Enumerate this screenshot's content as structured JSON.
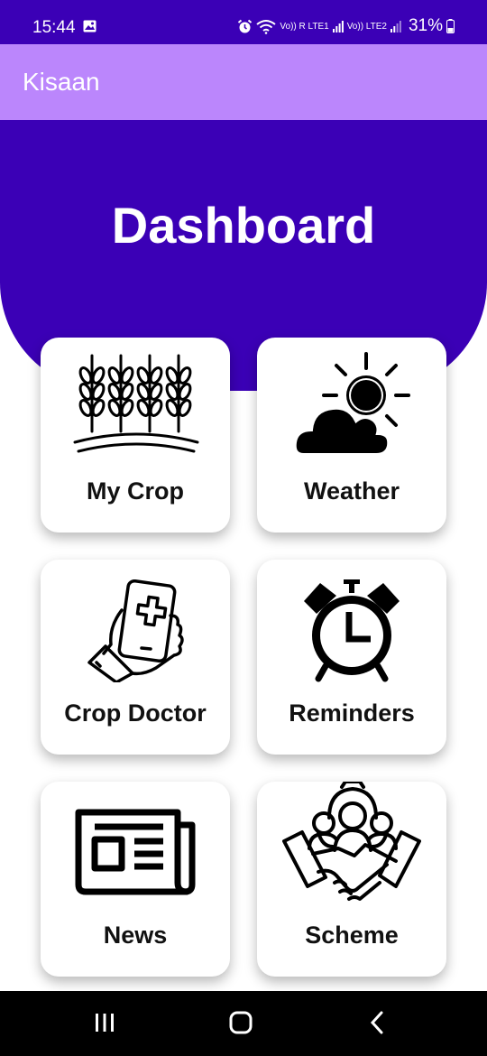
{
  "status_bar": {
    "time": "15:44",
    "network_label_1": "Vo)) R LTE1",
    "network_label_2": "Vo)) LTE2",
    "battery": "31%"
  },
  "app_bar": {
    "title": "Kisaan"
  },
  "hero": {
    "title": "Dashboard",
    "background_color": "#3b00b6"
  },
  "colors": {
    "primary": "#3b00b6",
    "app_bar": "#bb86fc"
  },
  "cards": [
    {
      "label": "My Crop",
      "icon": "wheat-icon"
    },
    {
      "label": "Weather",
      "icon": "weather-icon"
    },
    {
      "label": "Crop Doctor",
      "icon": "crop-doctor-icon"
    },
    {
      "label": "Reminders",
      "icon": "alarm-clock-icon"
    },
    {
      "label": "News",
      "icon": "newspaper-icon"
    },
    {
      "label": "Scheme",
      "icon": "handshake-icon"
    }
  ]
}
